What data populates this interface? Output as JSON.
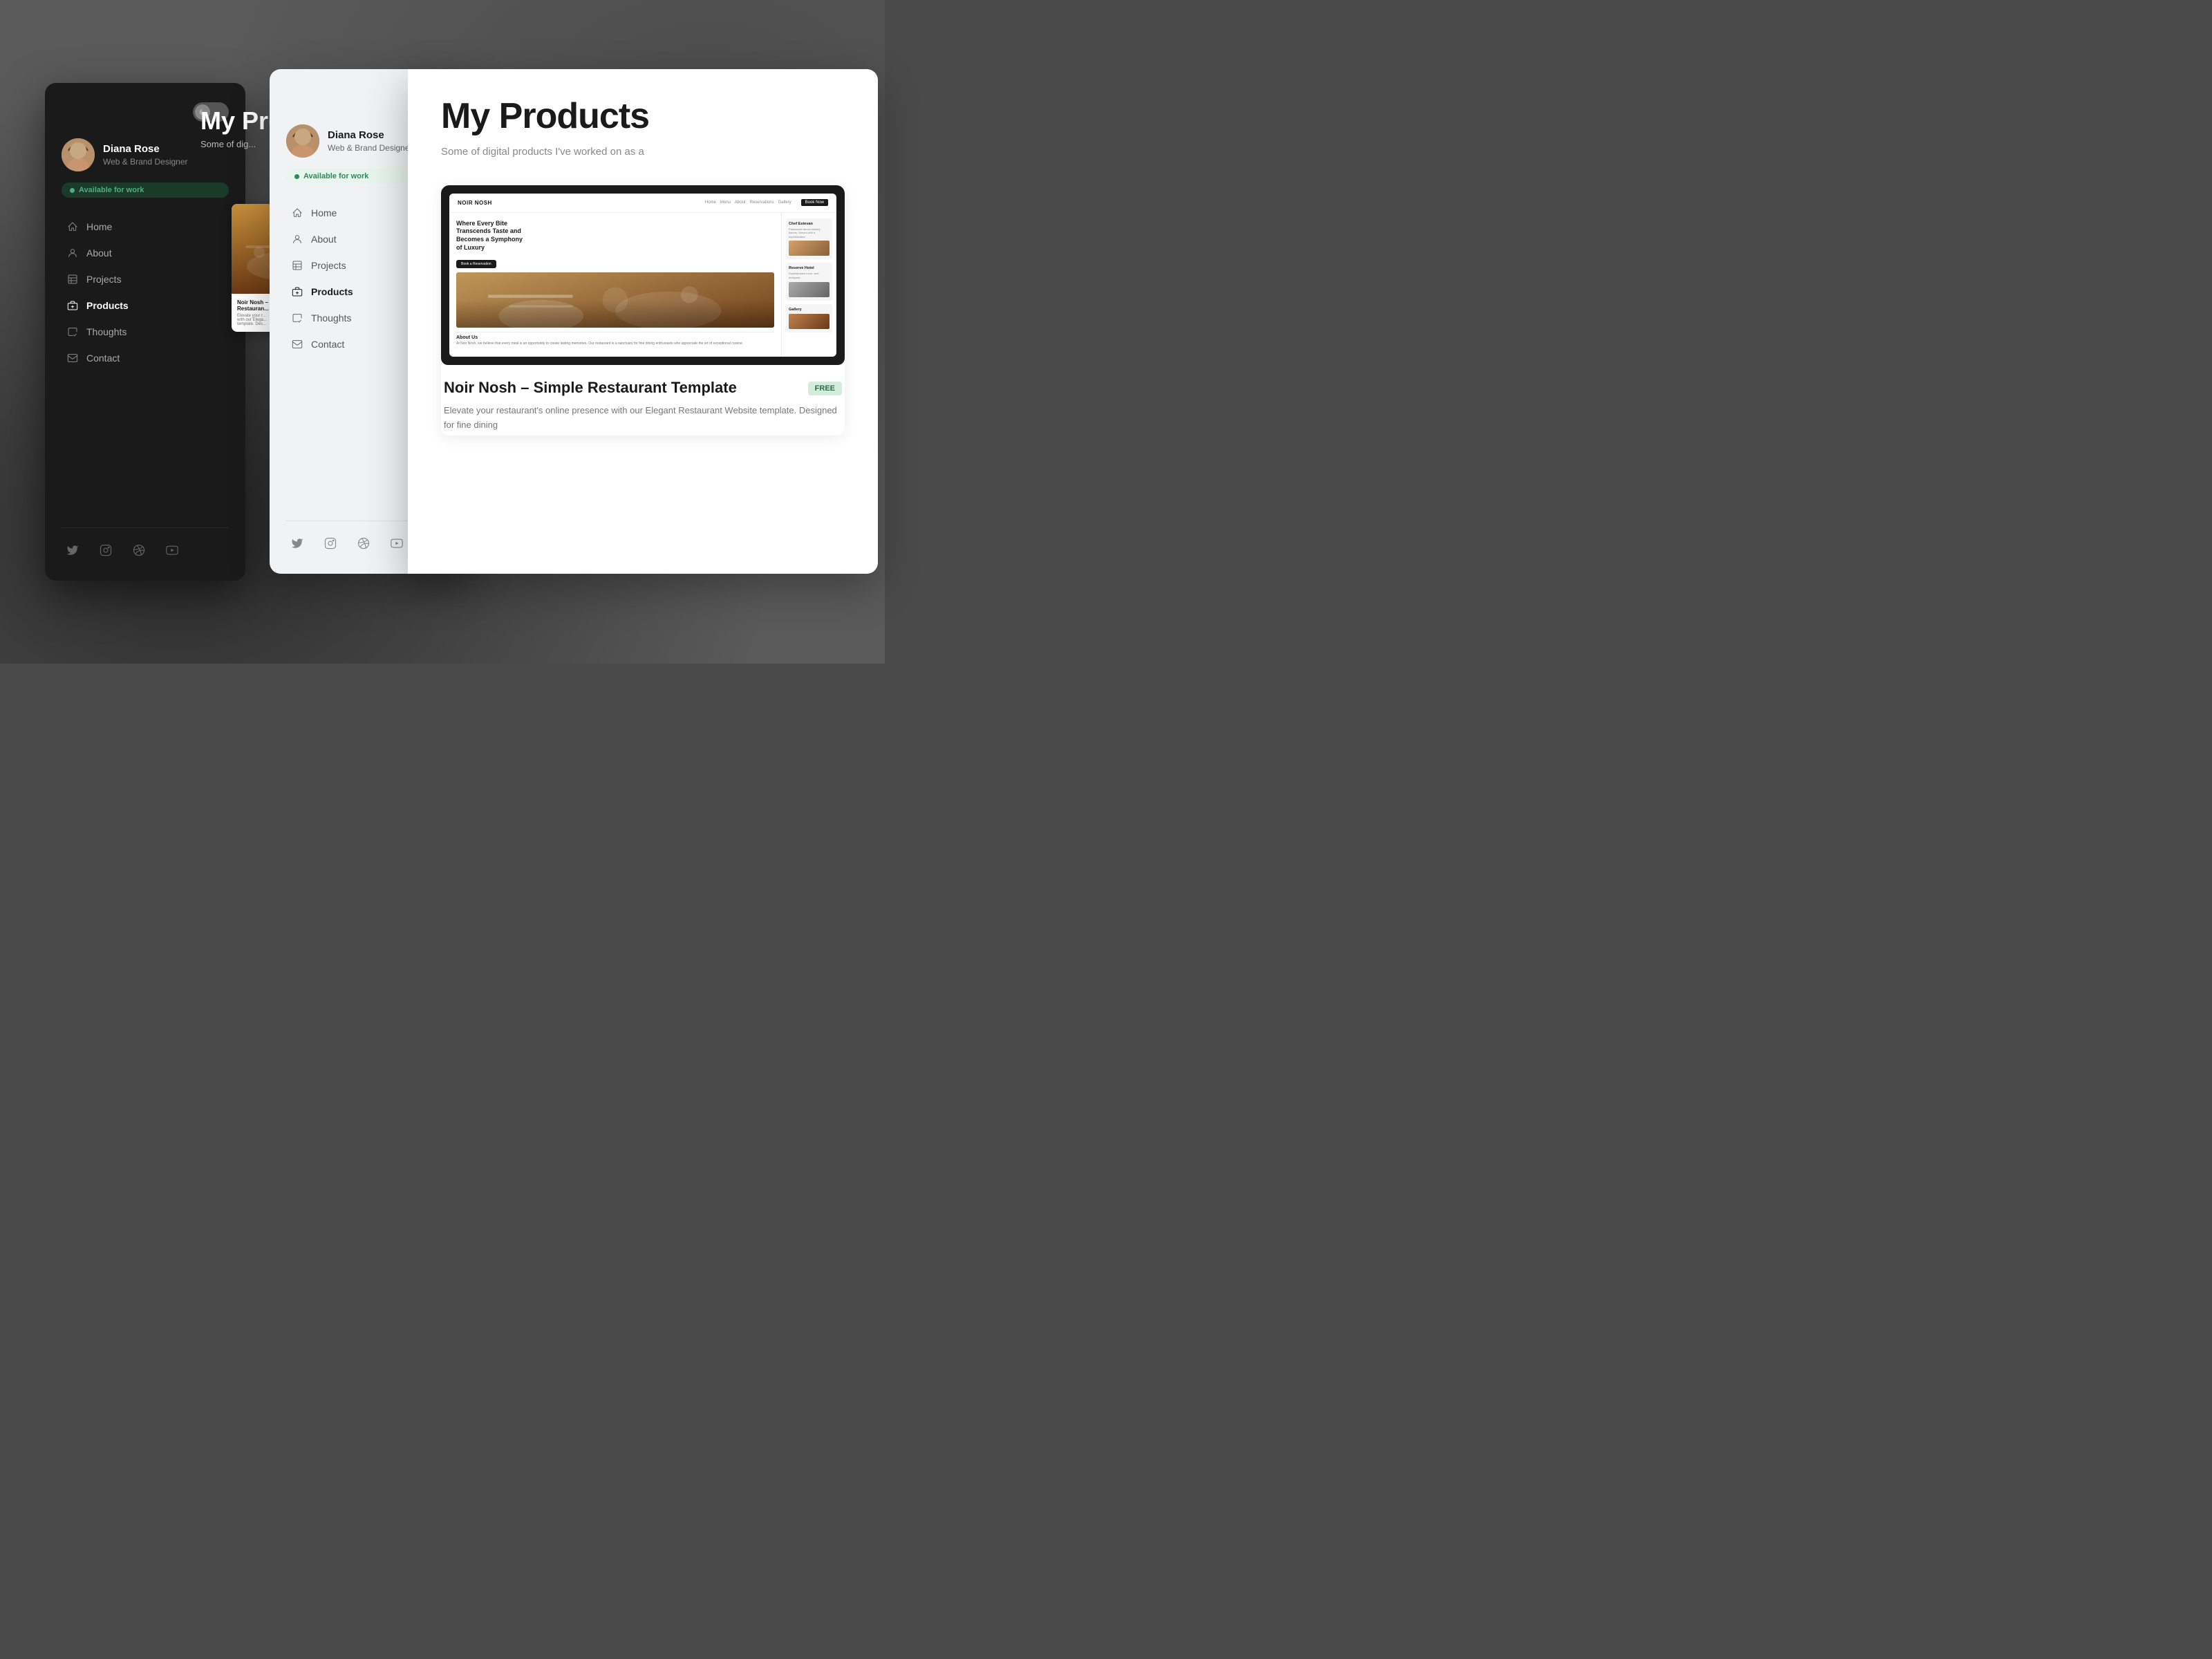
{
  "background": {
    "color": "#5a5a5a"
  },
  "dark_panel": {
    "theme_toggle": {
      "mode": "dark",
      "icon": "🌙"
    },
    "profile": {
      "name": "Diana Rose",
      "role": "Web & Brand Designer"
    },
    "available_badge": "Available for work",
    "nav_items": [
      {
        "id": "home",
        "label": "Home",
        "active": false
      },
      {
        "id": "about",
        "label": "About",
        "active": false
      },
      {
        "id": "projects",
        "label": "Projects",
        "active": false
      },
      {
        "id": "products",
        "label": "Products",
        "active": true
      },
      {
        "id": "thoughts",
        "label": "Thoughts",
        "active": false
      },
      {
        "id": "contact",
        "label": "Contact",
        "active": false
      }
    ],
    "social": {
      "twitter": "Twitter",
      "instagram": "Instagram",
      "dribbble": "Dribbble",
      "youtube": "YouTube"
    }
  },
  "light_panel": {
    "theme_toggle": {
      "mode": "light",
      "icon": "☀️"
    },
    "profile": {
      "name": "Diana Rose",
      "role": "Web & Brand Designer"
    },
    "available_badge": "Available for work",
    "nav_items": [
      {
        "id": "home",
        "label": "Home",
        "active": false
      },
      {
        "id": "about",
        "label": "About",
        "active": false
      },
      {
        "id": "projects",
        "label": "Projects",
        "active": false
      },
      {
        "id": "products",
        "label": "Products",
        "active": true
      },
      {
        "id": "thoughts",
        "label": "Thoughts",
        "active": false
      },
      {
        "id": "contact",
        "label": "Contact",
        "active": false
      }
    ],
    "social": {
      "twitter": "Twitter",
      "instagram": "Instagram",
      "dribbble": "Dribbble",
      "youtube": "YouTube"
    }
  },
  "main_panel": {
    "page_title": "My Products",
    "page_subtitle": "Some of digital products I've worked on as a",
    "product": {
      "name": "Noir Nosh – Simple Restaurant Template",
      "description": "Elevate your restaurant's online presence with our Elegant Restaurant Website template. Designed for fine dining",
      "badge": "FREE",
      "mock": {
        "logo": "NOIR NOSH",
        "headline": "Where Every Bite Transcends Taste and Becomes a Symphony of Luxury",
        "cta": "Book a Reservation",
        "about_label": "About Us",
        "sidebar_items": [
          {
            "title": "Chef Estevan",
            "desc": "Passionate about flavors"
          },
          {
            "title": "Reserve Hotel",
            "desc": "Sophisticated room"
          },
          {
            "title": "Gallery"
          }
        ]
      }
    }
  },
  "partial_overlay": {
    "title": "My Pr",
    "subtitle": "Some of dig"
  }
}
